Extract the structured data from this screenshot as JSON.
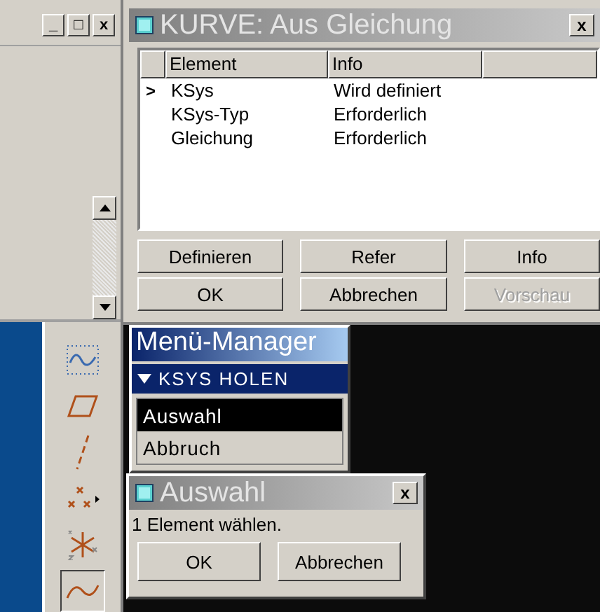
{
  "app_window": {
    "controls": [
      "_",
      "□",
      "x"
    ]
  },
  "dialog": {
    "title": "KURVE: Aus Gleichung",
    "close": "x",
    "active": false,
    "columns": [
      "Element",
      "Info"
    ],
    "rows": [
      {
        "element": "KSys",
        "info": "Wird definiert",
        "current": true
      },
      {
        "element": "KSys-Typ",
        "info": "Erforderlich",
        "current": false
      },
      {
        "element": "Gleichung",
        "info": "Erforderlich",
        "current": false
      }
    ],
    "current_marker": ">",
    "buttons": [
      {
        "label": "Definieren",
        "disabled": false
      },
      {
        "label": "Refer",
        "disabled": false
      },
      {
        "label": "Info",
        "disabled": false
      },
      {
        "label": "OK",
        "disabled": false
      },
      {
        "label": "Abbrechen",
        "disabled": false
      },
      {
        "label": "Vorschau",
        "disabled": true
      }
    ]
  },
  "toolbar": [
    {
      "kind": "wave",
      "pressed": false
    },
    {
      "kind": "plane",
      "pressed": false
    },
    {
      "kind": "axis",
      "pressed": false
    },
    {
      "kind": "points",
      "pressed": false
    },
    {
      "kind": "csys",
      "pressed": false
    },
    {
      "kind": "curve",
      "pressed": true
    }
  ],
  "menu_manager": {
    "title": "Menü-Manager",
    "section": "KSYS HOLEN",
    "items": [
      {
        "label": "Auswahl",
        "selected": true
      },
      {
        "label": "Abbruch",
        "selected": false
      }
    ]
  },
  "select_dialog": {
    "title": "Auswahl",
    "close": "x",
    "active": false,
    "message": "1 Element wählen.",
    "buttons": [
      "OK",
      "Abbrechen"
    ]
  }
}
